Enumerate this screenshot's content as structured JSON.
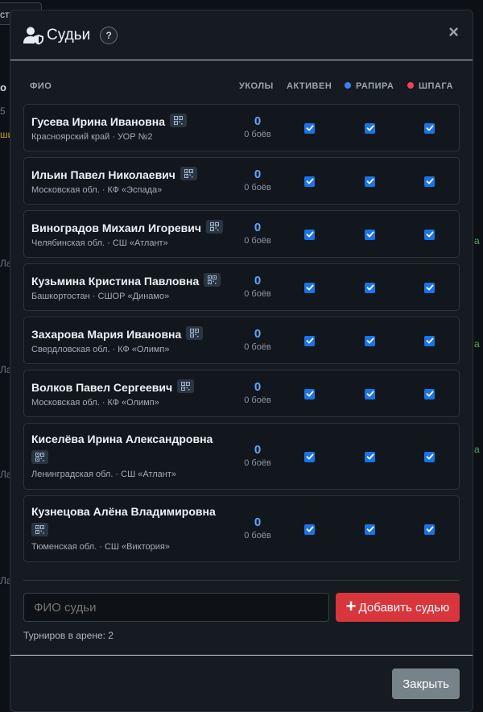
{
  "background": {
    "tab_label": "стр",
    "fragments": [
      "о 1",
      "5",
      "ши",
      "Ла",
      "Ла",
      "Ла",
      "Ла",
      "а",
      "а",
      "а"
    ]
  },
  "modal": {
    "title": "Судьи",
    "help": "?",
    "close_symbol": "×"
  },
  "table": {
    "headers": {
      "name": "ФИО",
      "touches": "УКОЛЫ",
      "active": "АКТИВЕН",
      "foil": "РАПИРА",
      "epee": "ШПАГА"
    },
    "foil_color": "#3b82f6",
    "epee_color": "#f43f5e",
    "referees": [
      {
        "name": "Гусева Ирина Ивановна",
        "region": "Красноярский край · УОР №2",
        "touches": "0",
        "bouts": "0 боёв",
        "active": true,
        "foil": true,
        "epee": true
      },
      {
        "name": "Ильин Павел Николаевич",
        "region": "Московская обл. · КФ «Эспада»",
        "touches": "0",
        "bouts": "0 боёв",
        "active": true,
        "foil": true,
        "epee": true
      },
      {
        "name": "Виноградов Михаил Игоревич",
        "region": "Челябинская обл. · СШ «Атлант»",
        "touches": "0",
        "bouts": "0 боёв",
        "active": true,
        "foil": true,
        "epee": true
      },
      {
        "name": "Кузьмина Кристина Павловна",
        "region": "Башкортостан · СШОР «Динамо»",
        "touches": "0",
        "bouts": "0 боёв",
        "active": true,
        "foil": true,
        "epee": true
      },
      {
        "name": "Захарова Мария Ивановна",
        "region": "Свердловская обл. · КФ «Олимп»",
        "touches": "0",
        "bouts": "0 боёв",
        "active": true,
        "foil": true,
        "epee": true
      },
      {
        "name": "Волков Павел Сергеевич",
        "region": "Московская обл. · КФ «Олимп»",
        "touches": "0",
        "bouts": "0 боёв",
        "active": true,
        "foil": true,
        "epee": true
      },
      {
        "name": "Киселёва Ирина Александровна",
        "region": "Ленинградская обл. · СШ «Атлант»",
        "touches": "0",
        "bouts": "0 боёв",
        "active": true,
        "foil": true,
        "epee": true
      },
      {
        "name": "Кузнецова Алёна Владимировна",
        "region": "Тюменская обл. · СШ «Виктория»",
        "touches": "0",
        "bouts": "0 боёв",
        "active": true,
        "foil": true,
        "epee": true
      }
    ]
  },
  "add_form": {
    "placeholder": "ФИО судьи",
    "add_label": "Добавить судью"
  },
  "tournaments_in_arena": "Турниров в арене: 2",
  "footer": {
    "close_label": "Закрыть"
  }
}
